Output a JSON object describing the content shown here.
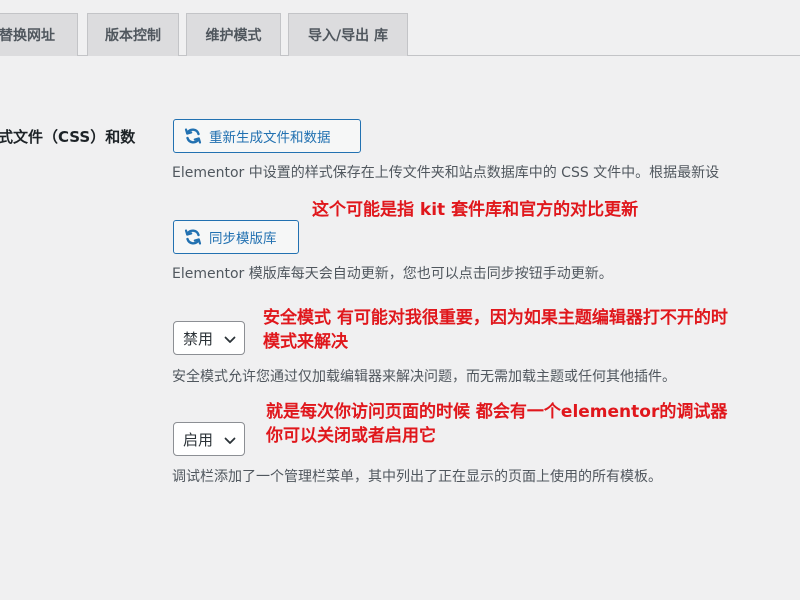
{
  "tabs": [
    {
      "label": "替换网址"
    },
    {
      "label": "版本控制"
    },
    {
      "label": "维护模式"
    },
    {
      "label": "导入/导出 库"
    }
  ],
  "css_row": {
    "label": "式文件（CSS）和数",
    "button_label": "重新生成文件和数据",
    "description": "Elementor 中设置的样式保存在上传文件夹和站点数据库中的 CSS 文件中。根据最新设"
  },
  "sync_row": {
    "button_label": "同步模版库",
    "description": "Elementor 模版库每天会自动更新，您也可以点击同步按钮手动更新。"
  },
  "safe_mode_row": {
    "selected": "禁用",
    "description": "安全模式允许您通过仅加载编辑器来解决问题，而无需加载主题或任何其他插件。"
  },
  "debug_row": {
    "selected": "启用",
    "description": "调试栏添加了一个管理栏菜单，其中列出了正在显示的页面上使用的所有模板。"
  },
  "annotations": {
    "note_1": "这个可能是指 kit 套件库和官方的对比更新",
    "note_2_line1": "安全模式 有可能对我很重要，因为如果主题编辑器打不开的时",
    "note_2_line2": "模式来解决",
    "note_3_line1": "就是每次你访问页面的时候 都会有一个elementor的调试器",
    "note_3_line2": "你可以关闭或者启用它"
  },
  "colors": {
    "background": "#f0f0f1",
    "accent": "#2271b1",
    "annotation": "#e0171c"
  },
  "icons": {
    "regenerate": "sync-icon",
    "sync": "sync-icon",
    "select": "chevron-down-icon"
  }
}
